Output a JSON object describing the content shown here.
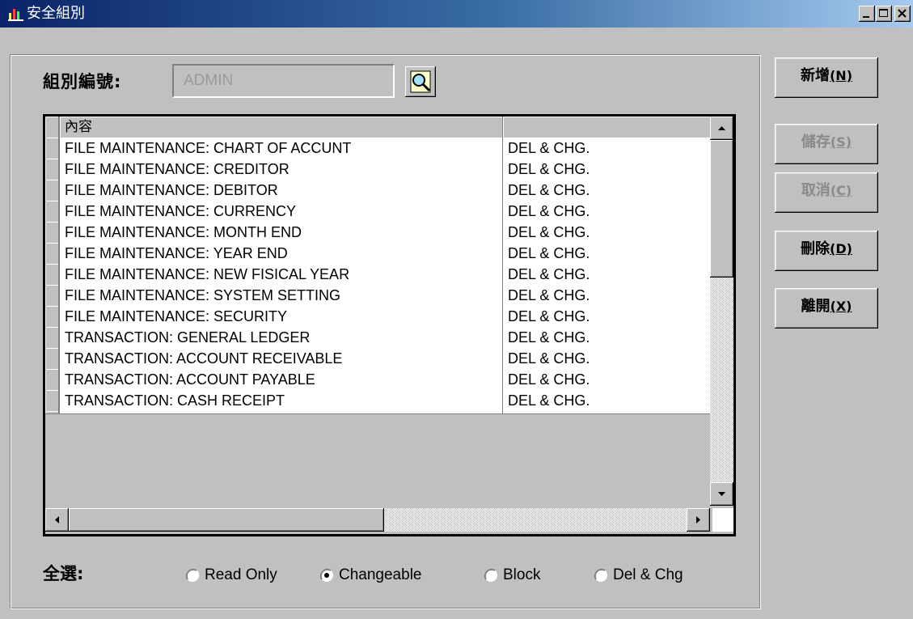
{
  "window": {
    "title": "安全組別"
  },
  "form": {
    "group_label": "組別編號:",
    "group_value": "ADMIN"
  },
  "grid": {
    "headers": [
      "內容",
      ""
    ],
    "rows": [
      {
        "content": "FILE MAINTENANCE: CHART OF ACCUNT",
        "access": "DEL & CHG."
      },
      {
        "content": "FILE MAINTENANCE: CREDITOR",
        "access": "DEL & CHG."
      },
      {
        "content": "FILE MAINTENANCE: DEBITOR",
        "access": "DEL & CHG."
      },
      {
        "content": "FILE MAINTENANCE: CURRENCY",
        "access": "DEL & CHG."
      },
      {
        "content": "FILE MAINTENANCE: MONTH END",
        "access": "DEL & CHG."
      },
      {
        "content": "FILE MAINTENANCE: YEAR END",
        "access": "DEL & CHG."
      },
      {
        "content": "FILE MAINTENANCE: NEW FISICAL YEAR",
        "access": "DEL & CHG."
      },
      {
        "content": "FILE MAINTENANCE: SYSTEM SETTING",
        "access": "DEL & CHG."
      },
      {
        "content": "FILE MAINTENANCE: SECURITY",
        "access": "DEL & CHG."
      },
      {
        "content": "TRANSACTION: GENERAL LEDGER",
        "access": "DEL & CHG."
      },
      {
        "content": "TRANSACTION: ACCOUNT RECEIVABLE",
        "access": "DEL & CHG."
      },
      {
        "content": "TRANSACTION: ACCOUNT PAYABLE",
        "access": "DEL & CHG."
      },
      {
        "content": "TRANSACTION: CASH RECEIPT",
        "access": "DEL & CHG."
      }
    ]
  },
  "select_all": {
    "label": "全選:",
    "options": [
      {
        "label": "Read Only",
        "checked": false
      },
      {
        "label": "Changeable",
        "checked": true
      },
      {
        "label": "Block",
        "checked": false
      },
      {
        "label": "Del & Chg",
        "checked": false
      }
    ]
  },
  "buttons": {
    "new": {
      "label": "新增",
      "accel": "(N)",
      "enabled": true
    },
    "save": {
      "label": "儲存",
      "accel": "(S)",
      "enabled": false
    },
    "cancel": {
      "label": "取消",
      "accel": "(C)",
      "enabled": false
    },
    "delete": {
      "label": "刪除",
      "accel": "(D)",
      "enabled": true
    },
    "exit": {
      "label": "離開",
      "accel": "(X)",
      "enabled": true
    }
  },
  "colors": {
    "face": "#c0c0c0",
    "title_start": "#0a246a",
    "title_end": "#a6caf0",
    "disabled_text": "#8a8a8a"
  }
}
